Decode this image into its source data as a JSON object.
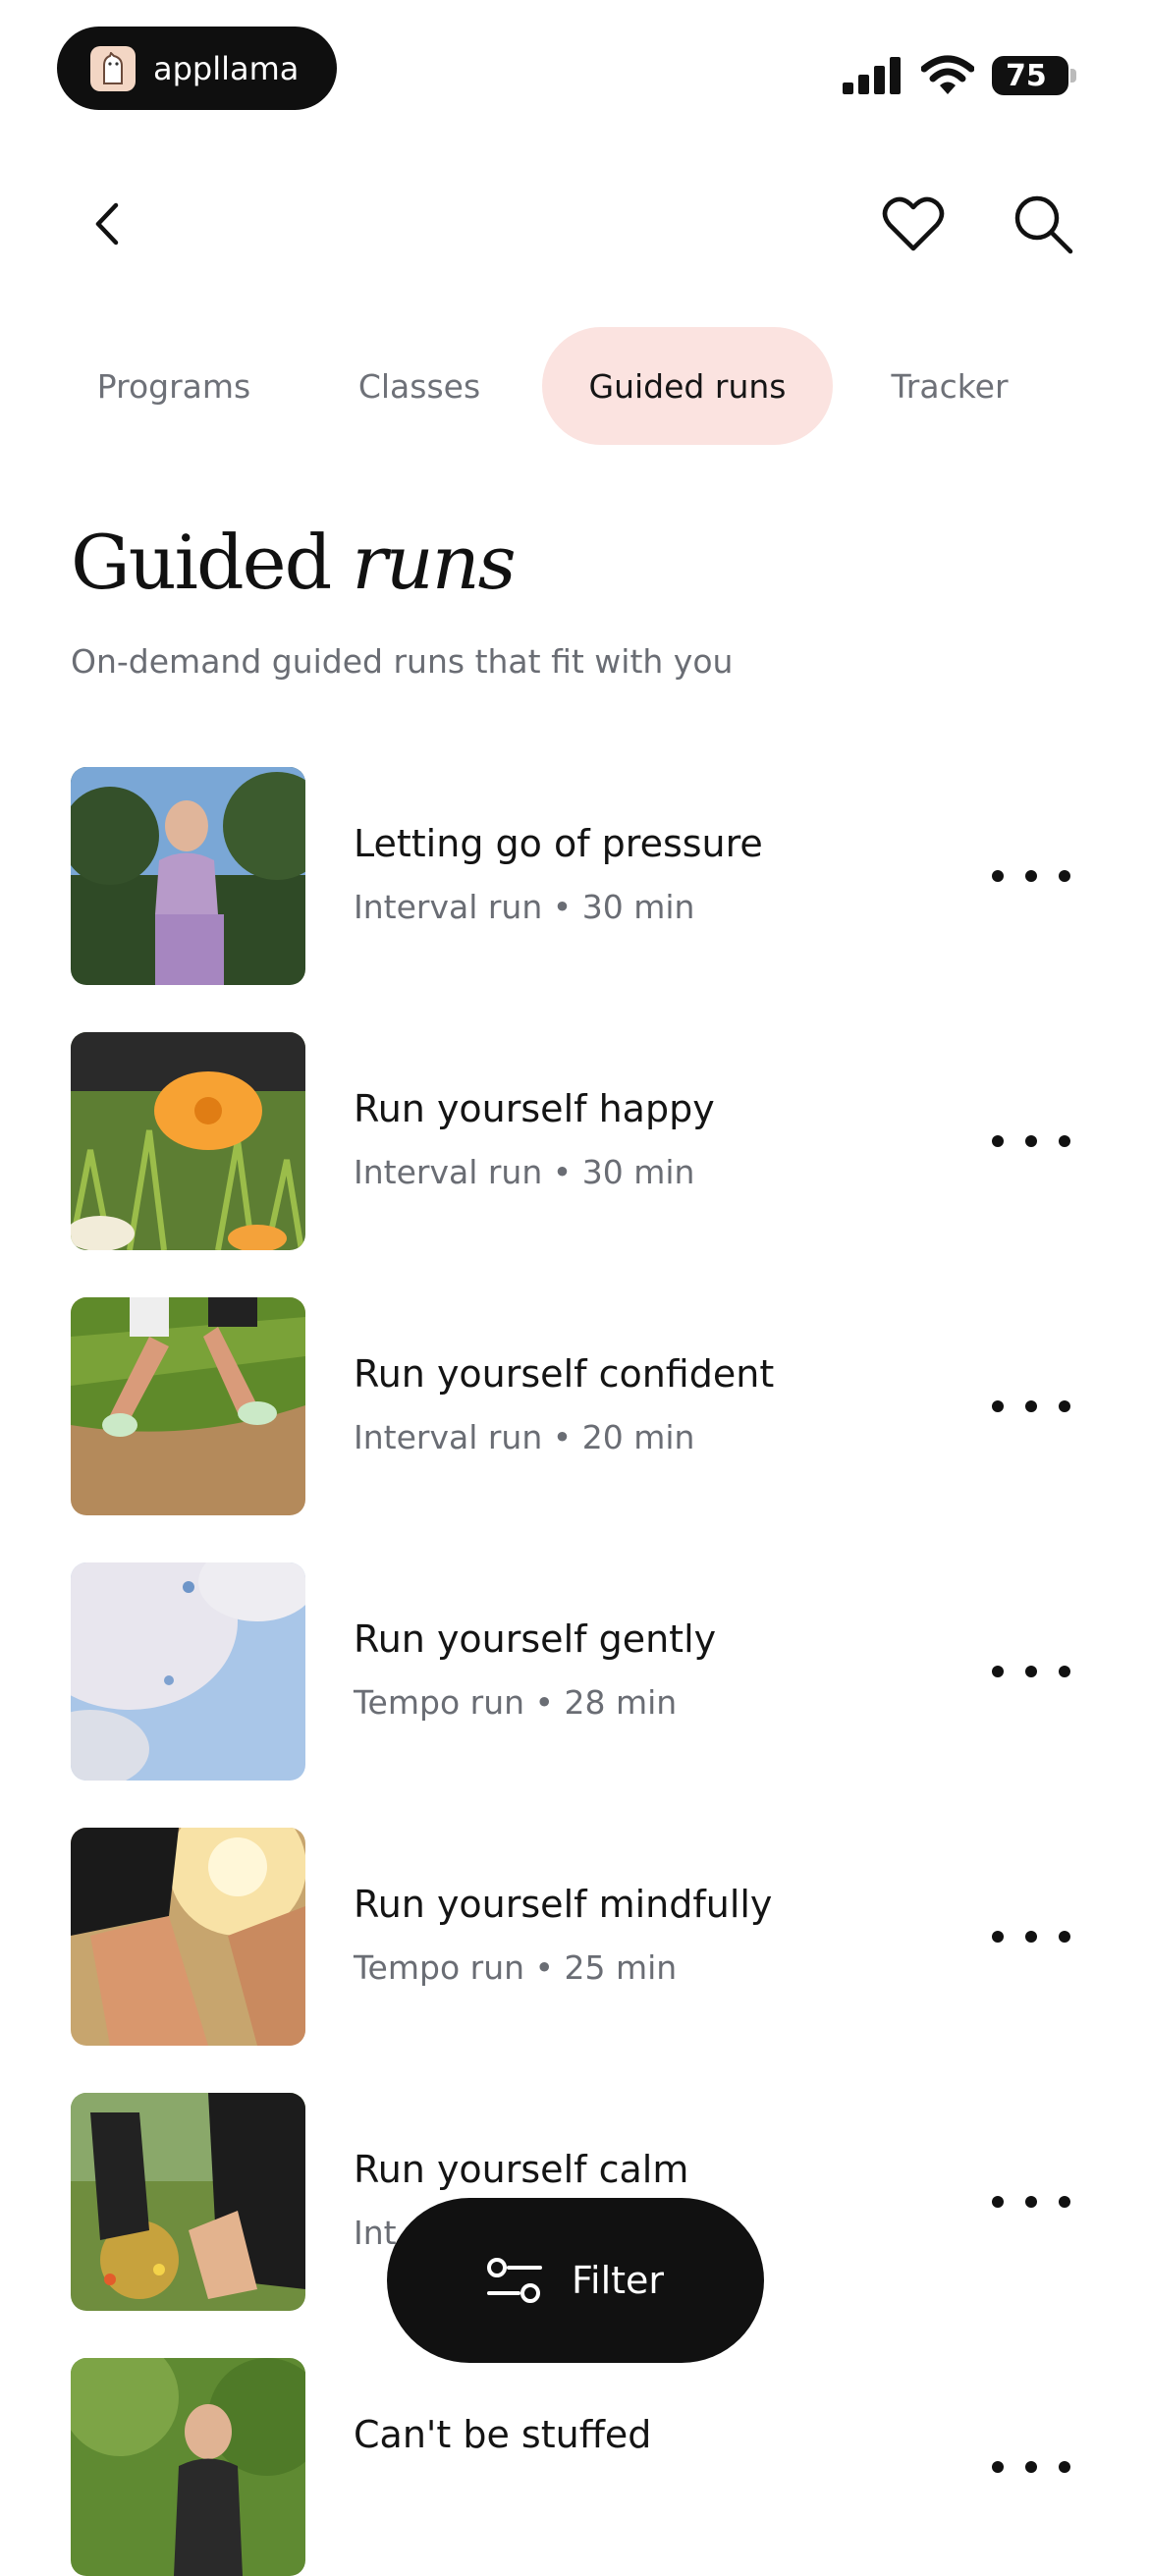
{
  "status_bar": {
    "brand_name": "appllama",
    "battery": "75"
  },
  "nav": {
    "back_icon": "chevron-left-icon",
    "favorites_icon": "heart-icon",
    "search_icon": "search-icon"
  },
  "tabs": [
    {
      "label": "Programs",
      "active": false
    },
    {
      "label": "Classes",
      "active": false
    },
    {
      "label": "Guided runs",
      "active": true
    },
    {
      "label": "Tracker",
      "active": false
    }
  ],
  "page": {
    "title_plain": "Guided",
    "title_italic": "runs",
    "subtitle": "On-demand guided runs that fit with you"
  },
  "runs": [
    {
      "title": "Letting go of pressure",
      "meta": "Interval run • 30 min"
    },
    {
      "title": "Run yourself happy",
      "meta": "Interval run • 30 min"
    },
    {
      "title": "Run yourself confident",
      "meta": "Interval run • 20 min"
    },
    {
      "title": "Run yourself gently",
      "meta": "Tempo run • 28 min"
    },
    {
      "title": "Run yourself mindfully",
      "meta": "Tempo run • 25 min"
    },
    {
      "title": "Run yourself calm",
      "meta": "Int"
    },
    {
      "title": "Can't be stuffed",
      "meta": ""
    }
  ],
  "filter": {
    "label": "Filter",
    "icon": "sliders-icon"
  },
  "colors": {
    "accent_tab_bg": "#fbe3e0",
    "filter_bg": "#111111",
    "meta_text": "#6a6d74"
  }
}
